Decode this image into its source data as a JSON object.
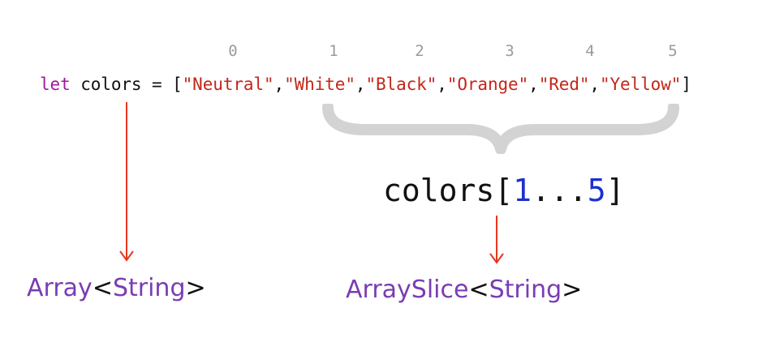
{
  "indices": [
    "0",
    "1",
    "2",
    "3",
    "4",
    "5"
  ],
  "code": {
    "keyword": "let",
    "variable": "colors",
    "equals": "=",
    "open_bracket": "[",
    "close_bracket": "]",
    "comma": ",",
    "items": [
      "\"Neutral\"",
      "\"White\"",
      "\"Black\"",
      "\"Orange\"",
      "\"Red\"",
      "\"Yellow\""
    ]
  },
  "slice_expression": {
    "name": "colors",
    "open": "[",
    "start": "1",
    "range_op": "...",
    "end": "5",
    "close": "]"
  },
  "left_type": {
    "name": "Array",
    "open": "<",
    "param": "String",
    "close": ">"
  },
  "right_type": {
    "name": "ArraySlice",
    "open": "<",
    "param": "String",
    "close": ">"
  },
  "colors": {
    "keyword": "#a0189e",
    "string": "#c4261a",
    "number": "#1c2fd0",
    "type": "#7a3cb4",
    "arrow": "#e8361f",
    "brace": "#d3d3d3",
    "index": "#9b9b9b"
  }
}
